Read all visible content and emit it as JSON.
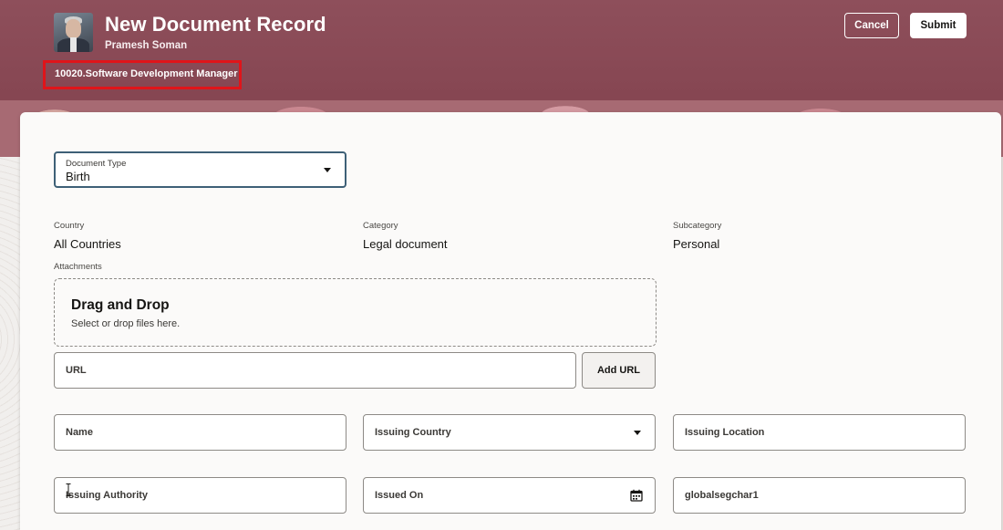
{
  "header": {
    "title": "New Document Record",
    "person_name": "Pramesh Soman",
    "assignment": "10020.Software Development Manager",
    "cancel_label": "Cancel",
    "submit_label": "Submit"
  },
  "form": {
    "document_type": {
      "label": "Document Type",
      "value": "Birth"
    },
    "country": {
      "label": "Country",
      "value": "All Countries"
    },
    "category": {
      "label": "Category",
      "value": "Legal document"
    },
    "subcategory": {
      "label": "Subcategory",
      "value": "Personal"
    },
    "attachments": {
      "label": "Attachments",
      "dropzone_title": "Drag and Drop",
      "dropzone_subtitle": "Select or drop files here.",
      "url_placeholder": "URL",
      "add_url_label": "Add URL"
    },
    "fields": {
      "name": "Name",
      "issuing_country": "Issuing Country",
      "issuing_location": "Issuing Location",
      "issuing_authority": "Issuing Authority",
      "issued_on": "Issued On",
      "globalsegchar1": "globalsegchar1"
    }
  },
  "icons": {
    "dropdown": "chevron-down-icon",
    "calendar": "calendar-icon",
    "text_cursor": "text-cursor-icon"
  },
  "colors": {
    "header_bg": "#874753",
    "highlight_border": "#e0141a",
    "focus_border": "#3e6077"
  }
}
